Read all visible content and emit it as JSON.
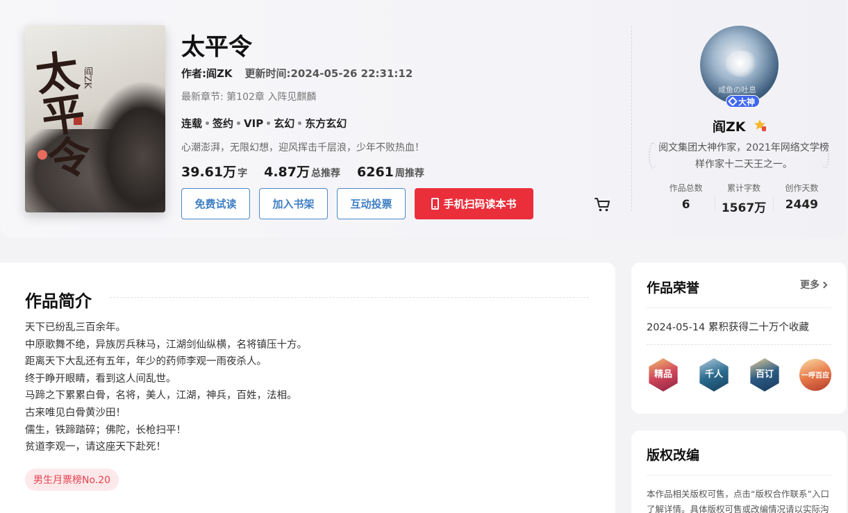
{
  "book": {
    "cover_title_art": "太平令",
    "cover_author_art": "阎ZK",
    "title": "太平令",
    "author_label": "作者:阎ZK",
    "updated_label": "更新时间:2024-05-26 22:31:12",
    "latest_chapter": "最新章节: 第102章 入阵见麒麟",
    "tags": [
      "连载",
      "签约",
      "VIP",
      "玄幻",
      "东方玄幻"
    ],
    "tagline": "心潮澎湃，无限幻想，迎风挥击千层浪，少年不败热血！",
    "stats": [
      {
        "num": "39.61万",
        "unit": "字"
      },
      {
        "num": "4.87万",
        "unit": "总推荐"
      },
      {
        "num": "6261",
        "unit": "周推荐"
      }
    ],
    "buttons": {
      "free_read": "免费试读",
      "add_shelf": "加入书架",
      "vote": "互动投票",
      "mobile_read": "手机扫码读本书"
    }
  },
  "author": {
    "avatar_watermark": "咸鱼の吐息",
    "badge": "大神",
    "name": "阎ZK",
    "desc": "阅文集团大神作家，2021年网络文学榜样作家十二天王之一。",
    "stats": [
      {
        "label": "作品总数",
        "value": "6"
      },
      {
        "label": "累计字数",
        "value": "1567万"
      },
      {
        "label": "创作天数",
        "value": "2449"
      }
    ]
  },
  "synopsis": {
    "title": "作品简介",
    "lines": [
      "天下已纷乱三百余年。",
      "中原歌舞不绝，异族厉兵秣马，江湖剑仙纵横，名将镇压十方。",
      "距离天下大乱还有五年，年少的药师李观一雨夜杀人。",
      "终于睁开眼睛，看到这人间乱世。",
      "马蹄之下累累白骨，名将，美人，江湖，神兵，百姓，法相。",
      "古来唯见白骨黄沙田！",
      "儒生，铁蹄踏碎；佛陀，长枪扫平！",
      "贫道李观一，请这座天下赴死！"
    ],
    "rank": "男生月票榜No.20"
  },
  "honor": {
    "title": "作品荣誉",
    "more": "更多",
    "item": "2024-05-14 累积获得二十万个收藏",
    "badges": [
      "精品",
      "千人",
      "百订",
      "一呼百应"
    ]
  },
  "copyright": {
    "title": "版权改编",
    "text": "本作品相关版权可售，点击“版权合作联系”入口了解详情。具体版权可售或改编情况请以实际沟通为准。"
  },
  "colors": {
    "accent_blue": "#3f7fc4",
    "primary_red": "#ea2f3b",
    "badge_blue": "#3f66f0",
    "rank_pink": "#fde8ea"
  }
}
